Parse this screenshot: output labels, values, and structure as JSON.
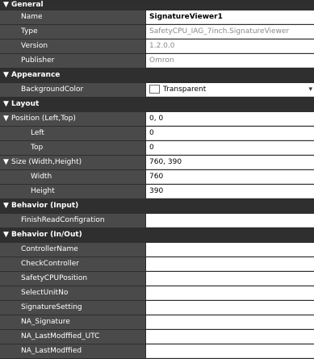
{
  "categories": {
    "general": "General",
    "appearance": "Appearance",
    "layout": "Layout",
    "behavior_input": "Behavior (Input)",
    "behavior_inout": "Behavior (In/Out)"
  },
  "general": {
    "name": {
      "label": "Name",
      "value": "SignatureViewer1"
    },
    "type": {
      "label": "Type",
      "value": "SafetyCPU_IAG_7inch.SignatureViewer"
    },
    "version": {
      "label": "Version",
      "value": "1.2.0.0"
    },
    "publisher": {
      "label": "Publisher",
      "value": "Omron"
    }
  },
  "appearance": {
    "background_color": {
      "label": "BackgroundColor",
      "value": "Transparent"
    }
  },
  "layout": {
    "position": {
      "label": "Position (Left,Top)",
      "value": "0, 0"
    },
    "left": {
      "label": "Left",
      "value": "0"
    },
    "top": {
      "label": "Top",
      "value": "0"
    },
    "size": {
      "label": "Size (Width,Height)",
      "value": "760, 390"
    },
    "width": {
      "label": "Width",
      "value": "760"
    },
    "height": {
      "label": "Height",
      "value": "390"
    }
  },
  "behavior_input": {
    "finish_read": {
      "label": "FinishReadConfigration",
      "value": ""
    }
  },
  "behavior_inout": [
    {
      "label": "ControllerName",
      "value": ""
    },
    {
      "label": "CheckController",
      "value": ""
    },
    {
      "label": "SafetyCPUPosition",
      "value": ""
    },
    {
      "label": "SelectUnitNo",
      "value": ""
    },
    {
      "label": "SignatureSetting",
      "value": ""
    },
    {
      "label": "NA_Signature",
      "value": ""
    },
    {
      "label": "NA_LastModffied_UTC",
      "value": ""
    },
    {
      "label": "NA_LastModffied",
      "value": ""
    }
  ],
  "icons": {
    "expand": "▼",
    "dropdown": "▾"
  }
}
